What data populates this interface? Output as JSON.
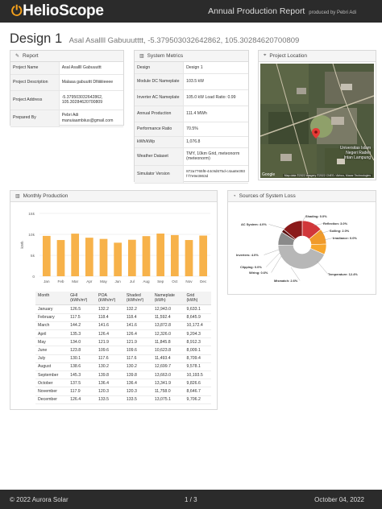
{
  "header": {
    "brand": "HelioScope",
    "report_title": "Annual Production Report",
    "produced_by": "produced by Pebri Adi"
  },
  "design": {
    "title": "Design 1",
    "subtitle": "Asal Asallll Gabuuutttt, -5.379503032642862, 105.30284620700809"
  },
  "report": {
    "heading": "Report",
    "rows": [
      {
        "key": "Project Name",
        "value": "Asal Asallll Gabuuuttt"
      },
      {
        "key": "Project Description",
        "value": "Malaaa gabuuttt Dfiiiiiiieeee"
      },
      {
        "key": "Project Address",
        "value": "-5.379503032642862, 105.30284620700809"
      },
      {
        "key": "Prepared By",
        "value": "Pebri Adi manuiaambiius@gmail.com"
      }
    ]
  },
  "metrics": {
    "heading": "System Metrics",
    "rows": [
      {
        "key": "Design",
        "value": "Design 1"
      },
      {
        "key": "Module DC Nameplate",
        "value": "103.5 kW"
      },
      {
        "key": "Inverter AC Nameplate",
        "value": "105.0 kW Load Ratio: 0.99"
      },
      {
        "key": "Annual Production",
        "value": "111.4 MWh"
      },
      {
        "key": "Performance Ratio",
        "value": "70.5%"
      },
      {
        "key": "kWh/kWp",
        "value": "1,076.8"
      },
      {
        "key": "Weather Dataset",
        "value": "TMY, 10km Grid, meteonorm (meteonorm)"
      },
      {
        "key": "Simulator Version",
        "value": "872a7765f8-44c9d675d-c4aa8e393f-f7e9e3863d"
      }
    ]
  },
  "location": {
    "heading": "Project Location",
    "map_label": "Universitas Islam Negeri Raden Intan Lampung",
    "google": "Google",
    "credit": "Map data ©2022 Imagery ©2022 CNES / Airbus, Maxar Technologies"
  },
  "monthly": {
    "heading": "Monthly Production",
    "headers": [
      [
        "Month"
      ],
      [
        "GHI",
        "(kWh/m²)"
      ],
      [
        "POA",
        "(kWh/m²)"
      ],
      [
        "Shaded",
        "(kWh/m²)"
      ],
      [
        "Nameplate",
        "(kWh)"
      ],
      [
        "Grid",
        "(kWh)"
      ]
    ],
    "rows": [
      [
        "January",
        "126.5",
        "132.2",
        "132.2",
        "12,943.0",
        "9,633.1"
      ],
      [
        "February",
        "117.5",
        "118.4",
        "118.4",
        "11,592.4",
        "8,645.9"
      ],
      [
        "March",
        "144.2",
        "141.6",
        "141.6",
        "13,872.8",
        "10,172.4"
      ],
      [
        "April",
        "135.3",
        "126.4",
        "126.4",
        "12,326.0",
        "9,204.3"
      ],
      [
        "May",
        "134.0",
        "121.9",
        "121.9",
        "11,845.8",
        "8,912.3"
      ],
      [
        "June",
        "123.8",
        "109.6",
        "109.6",
        "10,623.8",
        "8,009.1"
      ],
      [
        "July",
        "130.1",
        "117.6",
        "117.6",
        "11,493.4",
        "8,709.4"
      ],
      [
        "August",
        "138.6",
        "130.2",
        "130.2",
        "12,699.7",
        "9,578.1"
      ],
      [
        "September",
        "145.3",
        "139.8",
        "139.8",
        "13,663.0",
        "10,193.5"
      ],
      [
        "October",
        "137.5",
        "136.4",
        "136.4",
        "13,341.9",
        "9,826.6"
      ],
      [
        "November",
        "117.9",
        "120.3",
        "120.3",
        "11,758.0",
        "8,646.7"
      ],
      [
        "December",
        "126.4",
        "133.5",
        "133.5",
        "13,075.1",
        "9,706.2"
      ]
    ]
  },
  "chart_data": [
    {
      "type": "bar",
      "title": "",
      "xlabel": "",
      "ylabel": "kWh",
      "categories": [
        "Jan",
        "Feb",
        "Mar",
        "Apr",
        "May",
        "Jun",
        "Jul",
        "Aug",
        "Sep",
        "Oct",
        "Nov",
        "Dec"
      ],
      "values": [
        9633.1,
        8645.9,
        10172.4,
        9204.3,
        8912.3,
        8009.1,
        8709.4,
        9578.1,
        10193.5,
        9826.6,
        8646.7,
        9706.2
      ],
      "ylim": [
        0,
        15000
      ],
      "yticks": [
        "0",
        "5k",
        "10k",
        "15k"
      ],
      "grid": true,
      "color": "#f7b24a"
    },
    {
      "type": "pie",
      "title": "Sources of System Loss",
      "slices": [
        {
          "label": "AC System",
          "value": 4.0,
          "color": "#d1373a"
        },
        {
          "label": "Shading",
          "value": 0.0,
          "color": "#f5a623"
        },
        {
          "label": "Reflection",
          "value": 3.0,
          "color": "#f09a2a"
        },
        {
          "label": "Soiling",
          "value": 2.0,
          "color": "#f7a62c"
        },
        {
          "label": "Irradiance",
          "value": 0.0,
          "color": "#f8c36b"
        },
        {
          "label": "Temperature",
          "value": 12.4,
          "color": "#b7b7b7"
        },
        {
          "label": "Mismatch",
          "value": 2.6,
          "color": "#8a8a8a"
        },
        {
          "label": "Wiring",
          "value": 0.6,
          "color": "#5a1010"
        },
        {
          "label": "Clipping",
          "value": 0.0,
          "color": "#3a0808"
        },
        {
          "label": "Inverters",
          "value": 4.0,
          "color": "#8b1a1a"
        }
      ]
    }
  ],
  "loss": {
    "heading": "Sources of System Loss",
    "labels": [
      "AC System: 4.0%",
      "Shading: 0.0%",
      "Reflection: 3.0%",
      "Soiling: 2.0%",
      "Irradiance: 0.0%",
      "Temperature: 12.4%",
      "Mismatch: 2.6%",
      "Wiring: 0.6%",
      "Clipping: 0.0%",
      "Inverters: 4.0%"
    ]
  },
  "footer": {
    "copyright": "© 2022 Aurora Solar",
    "page": "1 / 3",
    "date": "October 04, 2022"
  }
}
